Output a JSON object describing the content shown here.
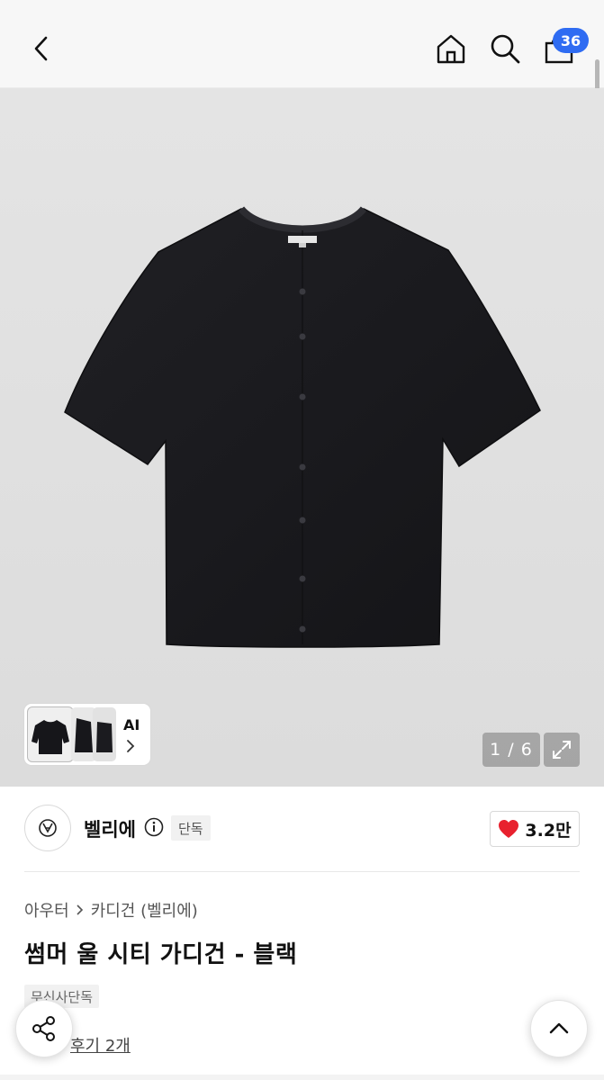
{
  "header": {
    "cart_count": "36",
    "icons": [
      "chevron-left-icon",
      "home-icon",
      "search-icon",
      "shopping-bag-icon"
    ]
  },
  "gallery": {
    "ai_label": "AI",
    "counter": "1 / 6"
  },
  "brand": {
    "name": "벨리에",
    "exclusive_tag": "단독",
    "likes": "3.2만"
  },
  "product": {
    "breadcrumb": [
      "아우터",
      "카디건 (벨리에)"
    ],
    "title": "썸머 울 시티 가디건 - 블랙",
    "exclusive_badge": "무신사단독",
    "reviews": "후기 2개"
  },
  "colors": {
    "badge": "#2f6cf2",
    "heart": "#e8212e",
    "garment": "#1c1c20"
  }
}
